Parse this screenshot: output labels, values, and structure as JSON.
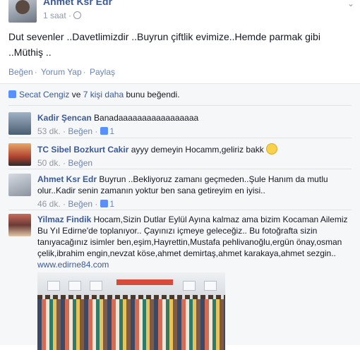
{
  "post": {
    "author": "Ahmet Ksr Edr",
    "time": "1 saat",
    "text": "Dut sevenler ..Davetlimizdir ..Buyrun çiftlik evimize..Hemde parmak gibi ..Müthiş ..",
    "actions": [
      "Beğen",
      "Yorum Yap",
      "Paylaş"
    ]
  },
  "likes": {
    "name": "Secat Cengiz",
    "middle": "ve",
    "others": "7 kişi daha",
    "suffix": "bunu beğendi."
  },
  "comments": [
    {
      "name": "Kadir Şencan",
      "text": "Banadaaaaaaaaaaaaaaaaa",
      "time": "53 dk.",
      "like": "Beğen",
      "count": "1"
    },
    {
      "name": "TC Sibel Bozkurt Cakir",
      "text": "ayyy demeyin Hocamm,geliriz bakk",
      "time": "50 dk.",
      "like": "Beğen"
    },
    {
      "name": "Ahmet Ksr Edr",
      "text": "Buyrun ..Bekliyoruz zamanı geçmeden..Şule Hanım da mutlu olur..Kadir senin zamanın yoktur ben sana getireyim en iyisi..",
      "time": "46 dk.",
      "like": "Beğen",
      "count": "1"
    },
    {
      "name": "Yilmaz Findik",
      "text": "Hocam,Sizin Dutlar Eylül Ayına kalmaz ama bizim Kocaman Ailemiz Bu Yıl Edirne'de toplanıyor.. Çayınızı içmeye geleceğiz.. Bu fotoğrafta sizin tanıyacağınız isimler ben,eşim,Hayrettin,Mustafa pehlivanoğlu,ergün önay,osman çelik,ibrahim engin,nevzat köse,ahmet demirtaş,ahmet karakaya,ahmet sezgin..",
      "url": "www.edirne84.com"
    }
  ],
  "icons": {
    "globe": "globe-icon",
    "like": "thumbs-up-icon",
    "emoji": "smile-emoji-icon",
    "menu": "chevron-down-icon"
  },
  "colors": {
    "link": "#3b5998",
    "muted": "#9197a3",
    "ufi_bg": "#f6f7f8"
  }
}
